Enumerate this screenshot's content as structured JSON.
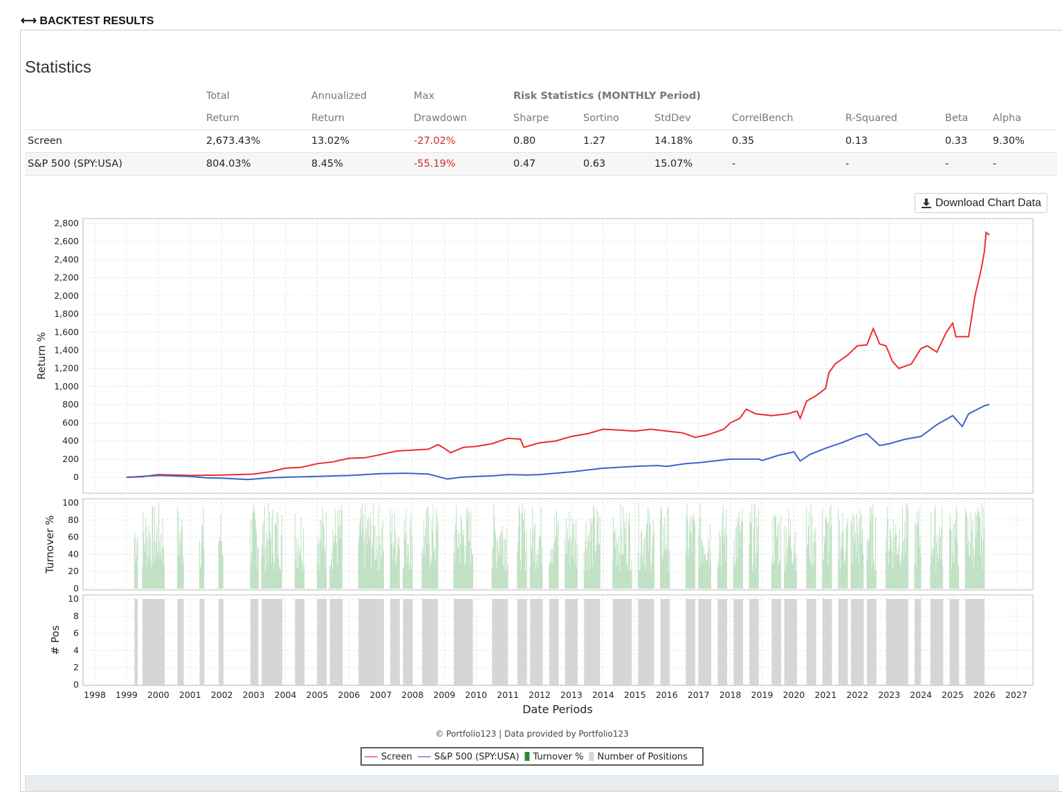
{
  "header": {
    "title": "BACKTEST RESULTS",
    "icon": "left-right-arrow-icon"
  },
  "statistics": {
    "title": "Statistics",
    "headers_top": [
      "",
      "Total",
      "Annualized",
      "Max",
      "Risk Statistics (MONTHLY Period)"
    ],
    "headers": [
      "",
      "Return",
      "Return",
      "Drawdown",
      "Sharpe",
      "Sortino",
      "StdDev",
      "CorrelBench",
      "R-Squared",
      "Beta",
      "Alpha"
    ],
    "rows": [
      [
        "Screen",
        "2,673.43%",
        "13.02%",
        "-27.02%",
        "0.80",
        "1.27",
        "14.18%",
        "0.35",
        "0.13",
        "0.33",
        "9.30%"
      ],
      [
        "S&P 500 (SPY:USA)",
        "804.03%",
        "8.45%",
        "-55.19%",
        "0.47",
        "0.63",
        "15.07%",
        "-",
        "-",
        "-",
        "-"
      ]
    ]
  },
  "download_label": "Download Chart Data",
  "chart_data": {
    "type": "line",
    "xlabel": "Date Periods",
    "x_ticks": [
      1998,
      1999,
      2000,
      2001,
      2002,
      2003,
      2004,
      2005,
      2006,
      2007,
      2008,
      2009,
      2010,
      2011,
      2012,
      2013,
      2014,
      2015,
      2016,
      2017,
      2018,
      2019,
      2020,
      2021,
      2022,
      2023,
      2024,
      2025,
      2026,
      2027
    ],
    "xlim": [
      1998,
      2027
    ],
    "panels": [
      {
        "ylabel": "Return %",
        "ylim": [
          0,
          2800
        ],
        "y_ticks": [
          "0",
          "200",
          "400",
          "600",
          "800",
          "1,000",
          "1,200",
          "1,400",
          "1,600",
          "1,800",
          "2,000",
          "2,200",
          "2,400",
          "2,600",
          "2,800"
        ]
      },
      {
        "ylabel": "Turnover %",
        "ylim": [
          0,
          100
        ],
        "y_ticks": [
          "0",
          "20",
          "40",
          "60",
          "80",
          "100"
        ]
      },
      {
        "ylabel": "# Pos",
        "ylim": [
          0,
          10
        ],
        "y_ticks": [
          "0",
          "2",
          "4",
          "6",
          "8",
          "10"
        ]
      }
    ],
    "series": [
      {
        "name": "Screen",
        "color": "#ee2b2b",
        "points": [
          [
            1999,
            0
          ],
          [
            1999.5,
            5
          ],
          [
            2000,
            30
          ],
          [
            2000.5,
            25
          ],
          [
            2001,
            20
          ],
          [
            2002,
            25
          ],
          [
            2003,
            35
          ],
          [
            2003.5,
            60
          ],
          [
            2004,
            100
          ],
          [
            2004.5,
            110
          ],
          [
            2005,
            150
          ],
          [
            2005.5,
            170
          ],
          [
            2006,
            210
          ],
          [
            2006.5,
            215
          ],
          [
            2007,
            250
          ],
          [
            2007.5,
            290
          ],
          [
            2008,
            300
          ],
          [
            2008.5,
            310
          ],
          [
            2008.8,
            360
          ],
          [
            2009,
            320
          ],
          [
            2009.2,
            270
          ],
          [
            2009.6,
            330
          ],
          [
            2010,
            340
          ],
          [
            2010.5,
            370
          ],
          [
            2011,
            430
          ],
          [
            2011.4,
            420
          ],
          [
            2011.5,
            330
          ],
          [
            2012,
            380
          ],
          [
            2012.5,
            400
          ],
          [
            2013,
            450
          ],
          [
            2013.5,
            480
          ],
          [
            2014,
            530
          ],
          [
            2014.5,
            520
          ],
          [
            2015,
            510
          ],
          [
            2015.5,
            530
          ],
          [
            2016,
            510
          ],
          [
            2016.5,
            490
          ],
          [
            2016.9,
            440
          ],
          [
            2017.3,
            470
          ],
          [
            2017.8,
            530
          ],
          [
            2018,
            600
          ],
          [
            2018.3,
            650
          ],
          [
            2018.5,
            750
          ],
          [
            2018.8,
            700
          ],
          [
            2019.3,
            680
          ],
          [
            2019.8,
            700
          ],
          [
            2020.1,
            730
          ],
          [
            2020.2,
            650
          ],
          [
            2020.4,
            840
          ],
          [
            2020.7,
            900
          ],
          [
            2021,
            980
          ],
          [
            2021.1,
            1150
          ],
          [
            2021.3,
            1250
          ],
          [
            2021.7,
            1350
          ],
          [
            2022,
            1450
          ],
          [
            2022.3,
            1460
          ],
          [
            2022.5,
            1640
          ],
          [
            2022.7,
            1470
          ],
          [
            2022.9,
            1450
          ],
          [
            2023.1,
            1280
          ],
          [
            2023.3,
            1200
          ],
          [
            2023.7,
            1250
          ],
          [
            2024,
            1420
          ],
          [
            2024.2,
            1450
          ],
          [
            2024.5,
            1380
          ],
          [
            2024.8,
            1600
          ],
          [
            2025,
            1700
          ],
          [
            2025.1,
            1550
          ],
          [
            2025.5,
            1550
          ],
          [
            2025.7,
            2000
          ],
          [
            2025.9,
            2300
          ],
          [
            2026,
            2500
          ],
          [
            2026.05,
            2700
          ],
          [
            2026.15,
            2673
          ]
        ]
      },
      {
        "name": "S&P 500 (SPY:USA)",
        "color": "#3a62c8",
        "points": [
          [
            1999,
            0
          ],
          [
            1999.5,
            10
          ],
          [
            2000,
            20
          ],
          [
            2000.5,
            15
          ],
          [
            2001,
            10
          ],
          [
            2001.5,
            -5
          ],
          [
            2002,
            -10
          ],
          [
            2002.8,
            -25
          ],
          [
            2003,
            -20
          ],
          [
            2003.5,
            -5
          ],
          [
            2004,
            0
          ],
          [
            2005,
            10
          ],
          [
            2006,
            20
          ],
          [
            2007,
            40
          ],
          [
            2007.8,
            45
          ],
          [
            2008.5,
            35
          ],
          [
            2009.1,
            -20
          ],
          [
            2009.5,
            0
          ],
          [
            2010,
            10
          ],
          [
            2010.5,
            15
          ],
          [
            2011,
            30
          ],
          [
            2011.6,
            25
          ],
          [
            2012,
            30
          ],
          [
            2013,
            60
          ],
          [
            2014,
            100
          ],
          [
            2015,
            120
          ],
          [
            2015.7,
            130
          ],
          [
            2016,
            120
          ],
          [
            2016.6,
            150
          ],
          [
            2017,
            160
          ],
          [
            2018,
            200
          ],
          [
            2018.9,
            200
          ],
          [
            2019,
            185
          ],
          [
            2019.5,
            240
          ],
          [
            2020,
            280
          ],
          [
            2020.2,
            180
          ],
          [
            2020.5,
            250
          ],
          [
            2021,
            320
          ],
          [
            2021.5,
            380
          ],
          [
            2022,
            450
          ],
          [
            2022.3,
            480
          ],
          [
            2022.7,
            350
          ],
          [
            2023,
            370
          ],
          [
            2023.5,
            420
          ],
          [
            2024,
            450
          ],
          [
            2024.5,
            580
          ],
          [
            2025,
            680
          ],
          [
            2025.3,
            560
          ],
          [
            2025.5,
            700
          ],
          [
            2026,
            790
          ],
          [
            2026.15,
            804
          ]
        ]
      },
      {
        "name": "Turnover %",
        "color": "#2e8b3a"
      },
      {
        "name": "Number of Positions",
        "color": "#d6d6d6"
      }
    ],
    "active_periods": [
      [
        1999.25,
        1999.35
      ],
      [
        1999.5,
        2000.2
      ],
      [
        2000.6,
        2000.8
      ],
      [
        2001.3,
        2001.45
      ],
      [
        2001.9,
        2002.05
      ],
      [
        2002.9,
        2003.15
      ],
      [
        2003.25,
        2003.9
      ],
      [
        2004.3,
        2004.6
      ],
      [
        2005.0,
        2005.3
      ],
      [
        2005.4,
        2005.8
      ],
      [
        2006.3,
        2007.1
      ],
      [
        2007.3,
        2007.6
      ],
      [
        2007.7,
        2008.0
      ],
      [
        2008.3,
        2008.8
      ],
      [
        2009.3,
        2009.9
      ],
      [
        2010.5,
        2011.0
      ],
      [
        2011.3,
        2011.6
      ],
      [
        2011.7,
        2012.1
      ],
      [
        2012.3,
        2012.6
      ],
      [
        2012.8,
        2013.2
      ],
      [
        2013.4,
        2013.9
      ],
      [
        2014.3,
        2014.9
      ],
      [
        2015.1,
        2015.6
      ],
      [
        2015.8,
        2016.1
      ],
      [
        2016.6,
        2016.9
      ],
      [
        2017.0,
        2017.4
      ],
      [
        2017.6,
        2017.9
      ],
      [
        2018.1,
        2018.4
      ],
      [
        2018.6,
        2018.9
      ],
      [
        2019.3,
        2019.6
      ],
      [
        2019.7,
        2020.1
      ],
      [
        2020.4,
        2020.7
      ],
      [
        2020.9,
        2021.2
      ],
      [
        2021.4,
        2021.7
      ],
      [
        2021.8,
        2022.2
      ],
      [
        2022.3,
        2022.6
      ],
      [
        2022.9,
        2023.6
      ],
      [
        2023.8,
        2024.0
      ],
      [
        2024.3,
        2024.7
      ],
      [
        2024.9,
        2025.2
      ],
      [
        2025.4,
        2026.0
      ]
    ],
    "positions_when_active": 10,
    "credit": "© Portfolio123 | Data provided by Portfolio123"
  }
}
